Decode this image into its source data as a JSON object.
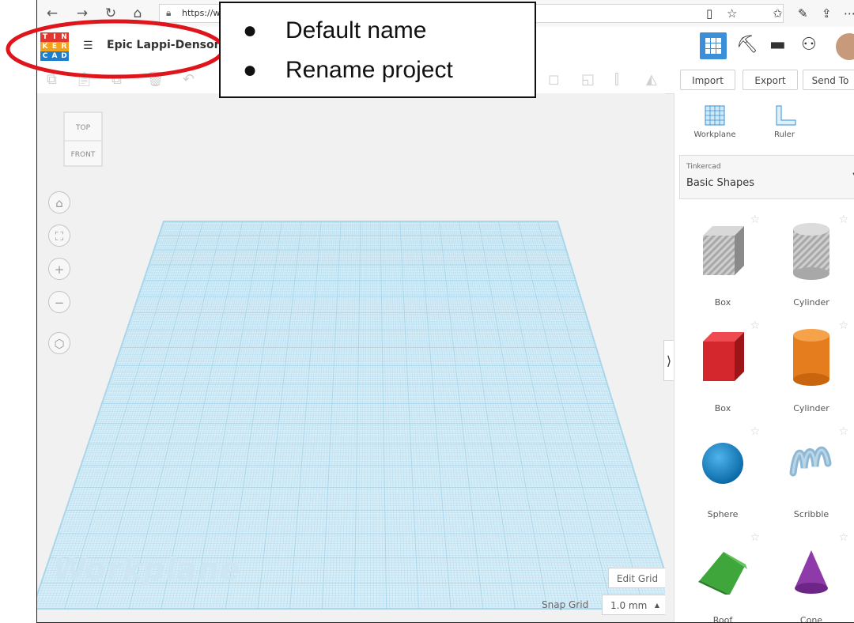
{
  "browser": {
    "url": "https://w",
    "nav": {
      "back": "←",
      "forward": "→",
      "reload": "↻",
      "home": "⌂"
    },
    "right_icons": [
      "reading-view-icon",
      "favorite-star-icon",
      "favorites-bar-icon",
      "pen-icon",
      "share-icon",
      "more-icon"
    ]
  },
  "app": {
    "logo_letters": [
      "T",
      "I",
      "N",
      "K",
      "E",
      "R",
      "C",
      "A",
      "D"
    ],
    "project_name": "Epic Lappi-Densor",
    "accent_color": "#3a8fd8"
  },
  "toolbar": {
    "import_label": "Import",
    "export_label": "Export",
    "sendto_label": "Send To"
  },
  "viewport": {
    "viewcube": {
      "top_label": "TOP",
      "front_label": "FRONT"
    },
    "workplane_label": "Workplane",
    "edit_grid_label": "Edit Grid",
    "snap_grid_label": "Snap Grid",
    "snap_grid_value": "1.0 mm",
    "grid_color": "#a9d6ea"
  },
  "panel": {
    "workplane_tool_label": "Workplane",
    "ruler_tool_label": "Ruler",
    "category_source": "Tinkercad",
    "category_name": "Basic Shapes",
    "shapes": [
      {
        "label": "Box",
        "color": "#a8a8a8"
      },
      {
        "label": "Cylinder",
        "color": "#a8a8a8"
      },
      {
        "label": "Box",
        "color": "#d3262d"
      },
      {
        "label": "Cylinder",
        "color": "#e57d1e"
      },
      {
        "label": "Sphere",
        "color": "#1a8fd0"
      },
      {
        "label": "Scribble",
        "color": "#8fb8d4"
      },
      {
        "label": "Roof",
        "color": "#3ea63a"
      },
      {
        "label": "Cone",
        "color": "#8e3aa8"
      }
    ]
  },
  "annotation": {
    "lines": [
      "Default name",
      "Rename project"
    ],
    "highlight_color": "#e0141b"
  }
}
